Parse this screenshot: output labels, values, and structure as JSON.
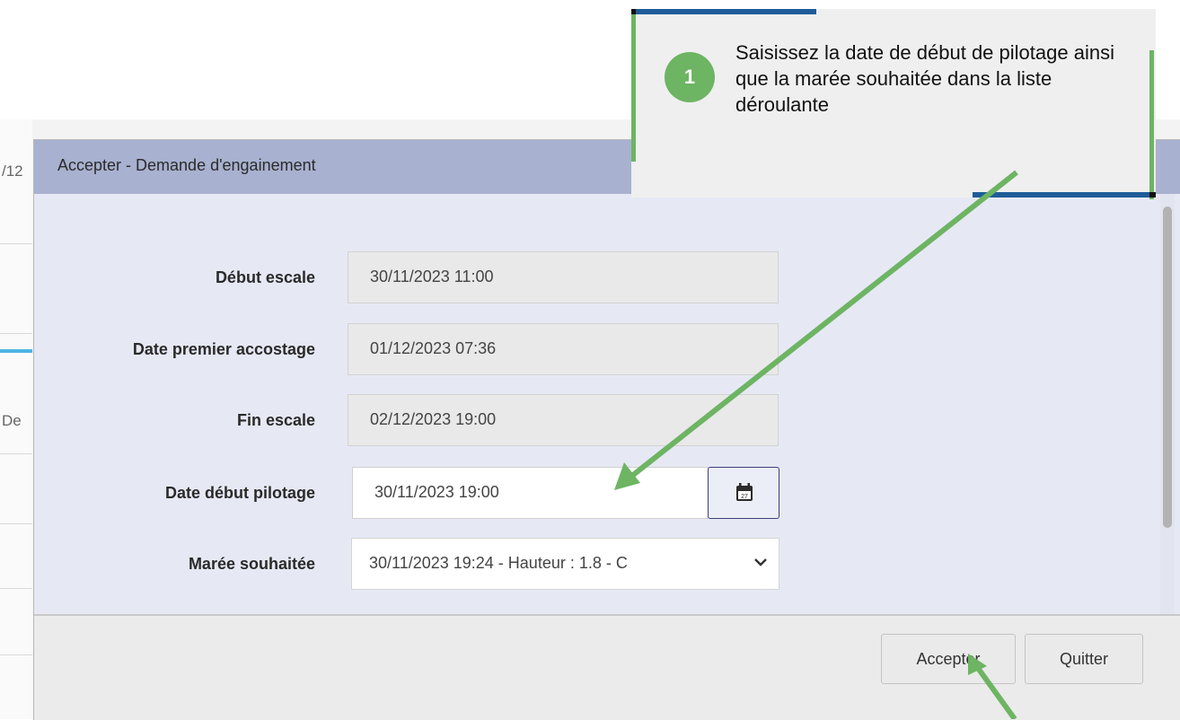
{
  "background": {
    "fragment_top": "/12",
    "fragment_mid": "De"
  },
  "modal": {
    "title": "Accepter - Demande d'engainement",
    "fields": [
      {
        "label": "Début escale",
        "value": "30/11/2023 11:00"
      },
      {
        "label": "Date premier accostage",
        "value": "01/12/2023 07:36"
      },
      {
        "label": "Fin escale",
        "value": "02/12/2023 19:00"
      },
      {
        "label": "Date début pilotage",
        "value": "30/11/2023 19:00"
      },
      {
        "label": "Marée souhaitée",
        "value": "30/11/2023 19:24 - Hauteur : 1.8 - C"
      }
    ],
    "calendar_icon": "calendar-icon",
    "calendar_day": "27",
    "buttons": {
      "accept": "Accepter",
      "quit": "Quitter"
    }
  },
  "callout": {
    "step_number": "1",
    "text": "Saisissez la date de début de pilotage ainsi que la marée souhaitée dans la liste déroulante"
  },
  "colors": {
    "header": "#a8b1cf",
    "body": "#e6e9f4",
    "arrow": "#6db463",
    "callout_accent_blue": "#1f5c99",
    "callout_accent_green": "#6db463"
  }
}
